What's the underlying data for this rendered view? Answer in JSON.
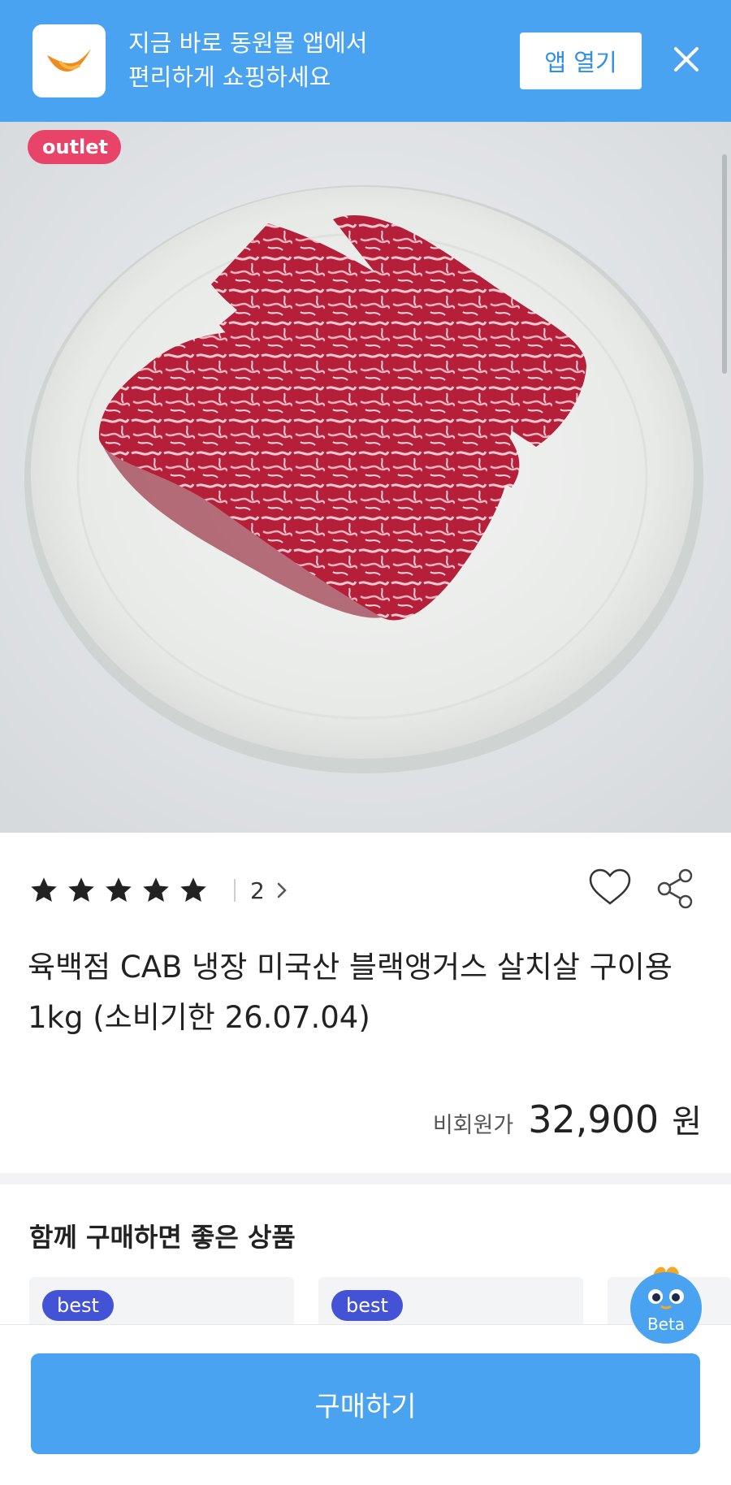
{
  "banner": {
    "line1": "지금 바로 동원몰 앱에서",
    "line2": "편리하게 쇼핑하세요",
    "open_label": "앱 열기",
    "logo_icon": "dongwon-mall-logo",
    "close_icon": "close-icon"
  },
  "product_image": {
    "badge": "outlet",
    "subject": "marbled beef slices on white plate"
  },
  "rating": {
    "stars": 5,
    "max_stars": 5,
    "review_count": "2"
  },
  "product": {
    "title": "육백점 CAB 냉장 미국산 블랙앵거스 살치살 구이용 1kg (소비기한 26.07.04)",
    "price_label": "비회원가",
    "price": "32,900",
    "currency": "원"
  },
  "recommend": {
    "title": "함께 구매하면 좋은 상품",
    "cards": [
      {
        "badge": "best"
      },
      {
        "badge": "best"
      }
    ]
  },
  "beta": {
    "label": "Beta"
  },
  "footer": {
    "buy_label": "구매하기"
  },
  "colors": {
    "brand_blue": "#4aa3f0",
    "outlet_pink": "#e8446a",
    "best_indigo": "#4453d6"
  }
}
